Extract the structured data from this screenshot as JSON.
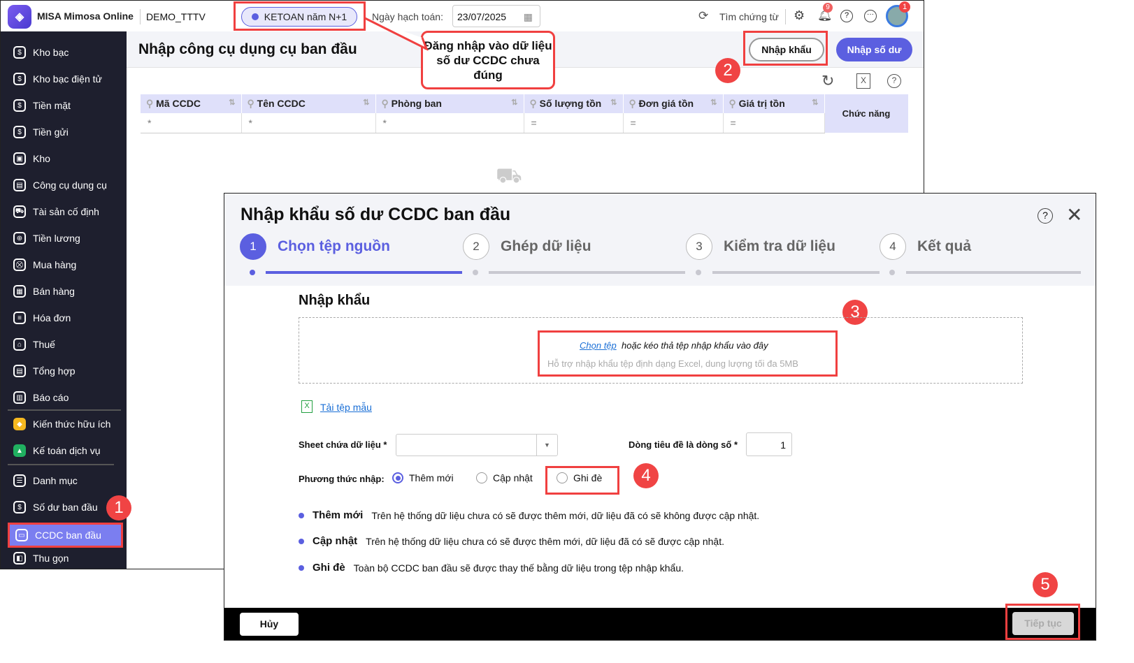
{
  "topbar": {
    "app_name": "MISA Mimosa Online",
    "company": "DEMO_TTTV",
    "database": "KETOAN năm N+1",
    "date_label": "Ngày hạch toán:",
    "date_value": "23/07/2025",
    "search_label": "Tìm chứng từ",
    "notif_count": "9",
    "avatar_badge": "1"
  },
  "sidebar": {
    "items": [
      {
        "label": "Kho bạc"
      },
      {
        "label": "Kho bạc điện tử"
      },
      {
        "label": "Tiền mặt"
      },
      {
        "label": "Tiền gửi"
      },
      {
        "label": "Kho"
      },
      {
        "label": "Công cụ dụng cụ"
      },
      {
        "label": "Tài sản cố định"
      },
      {
        "label": "Tiền lương"
      },
      {
        "label": "Mua hàng"
      },
      {
        "label": "Bán hàng"
      },
      {
        "label": "Hóa đơn"
      },
      {
        "label": "Thuế"
      },
      {
        "label": "Tổng hợp"
      },
      {
        "label": "Báo cáo"
      },
      {
        "label": "Kiến thức hữu ích"
      },
      {
        "label": "Kế toán dịch vụ"
      },
      {
        "label": "Danh mục"
      },
      {
        "label": "Số dư ban đầu"
      },
      {
        "label": "CCDC ban đầu"
      }
    ],
    "collapse": "Thu gọn"
  },
  "page": {
    "title": "Nhập công cụ dụng cụ ban đầu",
    "import_button": "Nhập khẩu",
    "enter_balance_button": "Nhập số dư",
    "columns": [
      "Mã CCDC",
      "Tên CCDC",
      "Phòng ban",
      "Số lượng tồn",
      "Đơn giá tồn",
      "Giá trị tồn",
      "Chức năng"
    ],
    "filters": [
      "*",
      "*",
      "*",
      "=",
      "=",
      "="
    ]
  },
  "callout": "Đăng nhập vào dữ liệu số dư CCDC chưa đúng",
  "markers": [
    "1",
    "2",
    "3",
    "4",
    "5"
  ],
  "dialog": {
    "title": "Nhập khẩu số dư CCDC ban đầu",
    "steps": [
      {
        "num": "1",
        "label": "Chọn tệp nguồn"
      },
      {
        "num": "2",
        "label": "Ghép dữ liệu"
      },
      {
        "num": "3",
        "label": "Kiểm tra dữ liệu"
      },
      {
        "num": "4",
        "label": "Kết quả"
      }
    ],
    "section_title": "Nhập khẩu",
    "choose_file": "Chọn tệp",
    "drop_text": "hoặc kéo thả tệp nhập khẩu vào đây",
    "support_text": "Hỗ trợ nhập khẩu tệp định dạng Excel, dung lượng tối đa 5MB",
    "template_link": "Tải tệp mẫu",
    "sheet_label": "Sheet chứa dữ liệu *",
    "sheet_value": "",
    "header_row_label": "Dòng tiêu đề là dòng số *",
    "header_row_value": "1",
    "method_label": "Phương thức nhập:",
    "methods": [
      "Thêm mới",
      "Cập nhật",
      "Ghi đè"
    ],
    "descriptions": [
      {
        "term": "Thêm mới",
        "text": "Trên hệ thống dữ liệu chưa có sẽ được thêm mới, dữ liệu đã có sẽ không được cập nhật."
      },
      {
        "term": "Cập nhật",
        "text": "Trên hệ thống dữ liệu chưa có sẽ được thêm mới, dữ liệu đã có sẽ được cập nhật."
      },
      {
        "term": "Ghi đè",
        "text": "Toàn bộ CCDC ban đầu sẽ được thay thế bằng dữ liệu trong tệp nhập khẩu."
      }
    ],
    "cancel": "Hủy",
    "continue": "Tiếp tục"
  }
}
